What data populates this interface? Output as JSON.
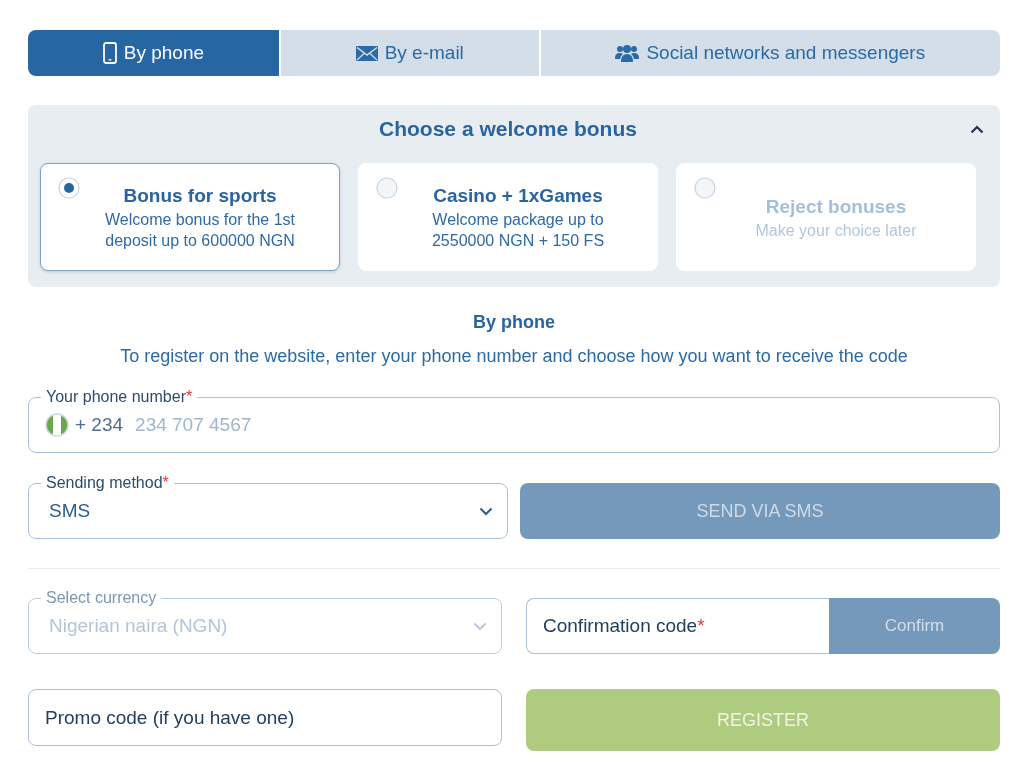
{
  "tabs": [
    {
      "label": "By phone",
      "selected": true
    },
    {
      "label": "By e-mail",
      "selected": false
    },
    {
      "label": "Social networks and messengers",
      "selected": false
    }
  ],
  "bonus": {
    "title": "Choose a welcome bonus",
    "expanded": true,
    "options": [
      {
        "kind": "bonus",
        "title": "Bonus for sports",
        "description": "Welcome bonus for the 1st deposit up to 600000 NGN",
        "selected": true
      },
      {
        "kind": "bonus",
        "title": "Casino + 1xGames",
        "description": "Welcome package up to 2550000 NGN + 150 FS",
        "selected": false
      },
      {
        "kind": "reject",
        "title": "Reject bonuses",
        "description": "Make your choice later",
        "selected": false
      }
    ]
  },
  "section": {
    "heading": "By phone",
    "description": "To register on the website, enter your phone number and choose how you want to receive the code"
  },
  "phone": {
    "label": "Your phone number",
    "required_mark": "*",
    "country_code": "+ 234",
    "placeholder": "234 707 4567"
  },
  "sending_method": {
    "label": "Sending method",
    "required_mark": "*",
    "value": "SMS",
    "disabled": false
  },
  "send_button": {
    "label": "SEND VIA SMS",
    "disabled": true
  },
  "currency": {
    "label": "Select currency",
    "value": "Nigerian naira (NGN)",
    "disabled": true
  },
  "confirmation": {
    "placeholder": "Confirmation code",
    "required_mark": "*",
    "button": "Confirm",
    "button_disabled": true
  },
  "promo": {
    "placeholder": "Promo code (if you have one)"
  },
  "register_button": {
    "label": "REGISTER",
    "disabled": true
  }
}
